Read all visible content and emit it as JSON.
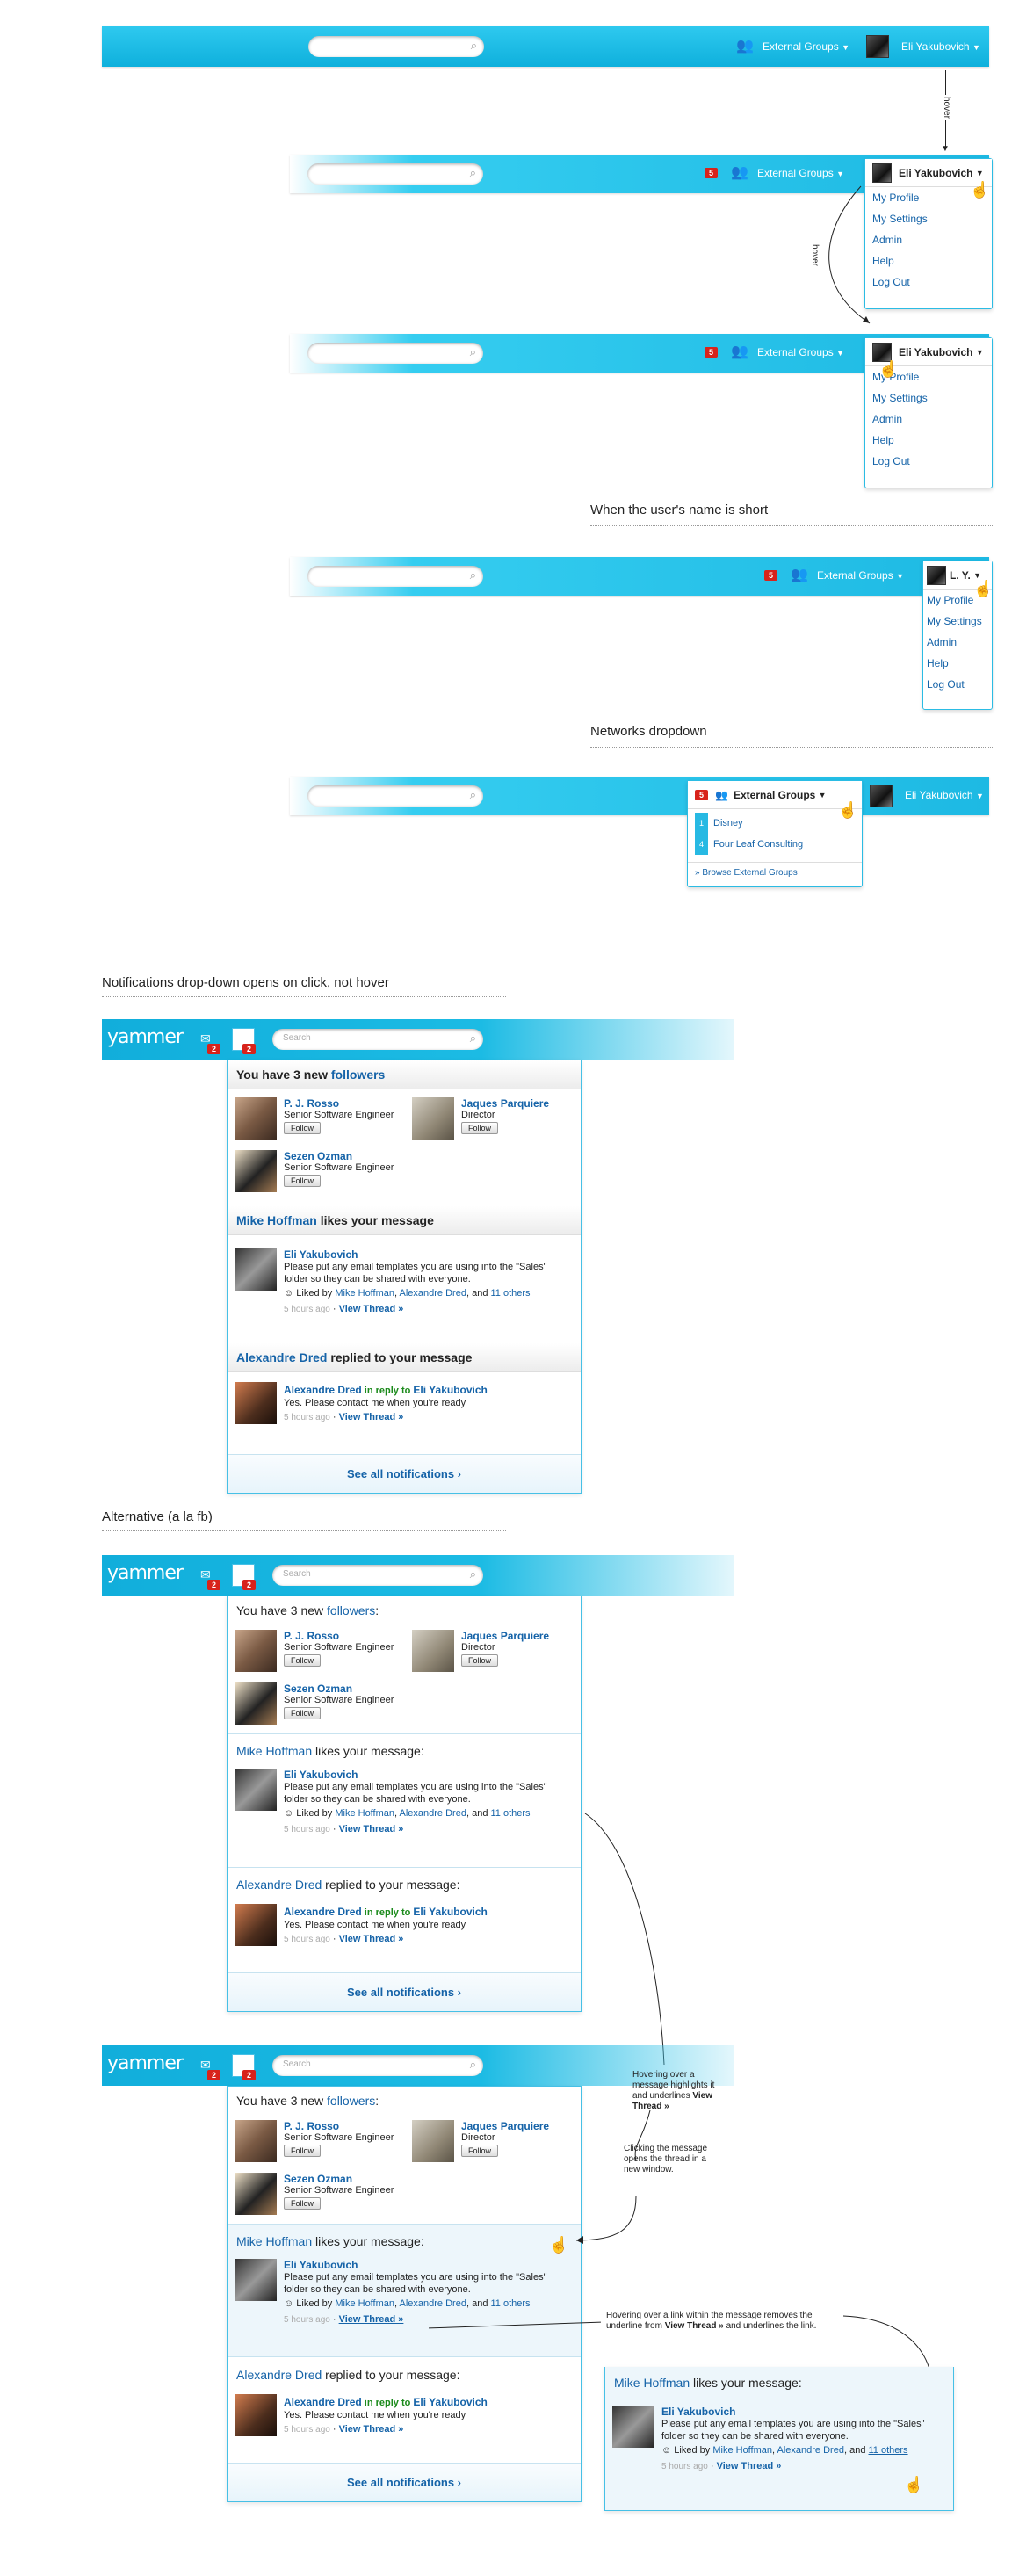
{
  "colors": {
    "accent": "#1db9e3",
    "link": "#1563a8",
    "badge": "#d8231b",
    "reply": "#1b8a1b"
  },
  "header": {
    "networks_label": "External Groups",
    "user_name": "Eli Yakubovich",
    "short_user_name": "L. Y.",
    "badge_count": "5",
    "search_icon": "search-icon",
    "groups_icon": "groups-icon"
  },
  "user_menu": {
    "items": [
      "My Profile",
      "My Settings",
      "Admin",
      "Help",
      "Log Out"
    ]
  },
  "labels": {
    "hover": "hover",
    "short_name": "When the user's name is short",
    "networks_dropdown": "Networks dropdown",
    "notif_click": "Notifications drop-down opens on click, not hover",
    "alternative": "Alternative (a la fb)"
  },
  "networks_menu": {
    "title": "External Groups",
    "items": [
      {
        "count": "1",
        "label": "Disney"
      },
      {
        "count": "4",
        "label": "Four Leaf Consulting"
      }
    ],
    "browse": "» Browse External Groups"
  },
  "yammer": {
    "logo": "yammer",
    "search_placeholder": "Search",
    "msg_count": "2",
    "notif_count": "2"
  },
  "notif": {
    "followers_prefix": "You have 3 new",
    "followers_word": "followers",
    "followers_suffix": ":",
    "people": [
      {
        "name": "P. J. Rosso",
        "title": "Senior Software Engineer"
      },
      {
        "name": "Jaques Parquiere",
        "title": "Director"
      },
      {
        "name": "Sezen Ozman",
        "title": "Senior Software Engineer"
      }
    ],
    "follow": "Follow",
    "like_actor": "Mike Hoffman",
    "like_text": "likes your message",
    "msg_author": "Eli Yakubovich",
    "msg_body": "Please put any email templates you are using into the \"Sales\" folder so they can be shared with everyone.",
    "liked_by_prefix": "Liked by",
    "liked_1": "Mike Hoffman",
    "liked_2": "Alexandre Dred",
    "liked_and": "and",
    "liked_others": "11 others",
    "time": "5 hours ago",
    "view_thread": "View Thread »",
    "reply_actor": "Alexandre Dred",
    "reply_text": "replied to your message",
    "reply_in": "in reply to",
    "reply_target": "Eli Yakubovich",
    "reply_body": "Yes. Please contact me when you're ready",
    "see_all": "See all notifications ›"
  },
  "notes": {
    "hover_msg_1": "Hovering over a message highlights it and underlines",
    "hover_msg_2": "View Thread",
    "click_msg": "Clicking the message opens the thread in a new window.",
    "hover_link_1": "Hovering over a link within the message removes the underline from",
    "hover_link_2": "View Thread",
    "hover_link_3": "and underlines the link."
  }
}
